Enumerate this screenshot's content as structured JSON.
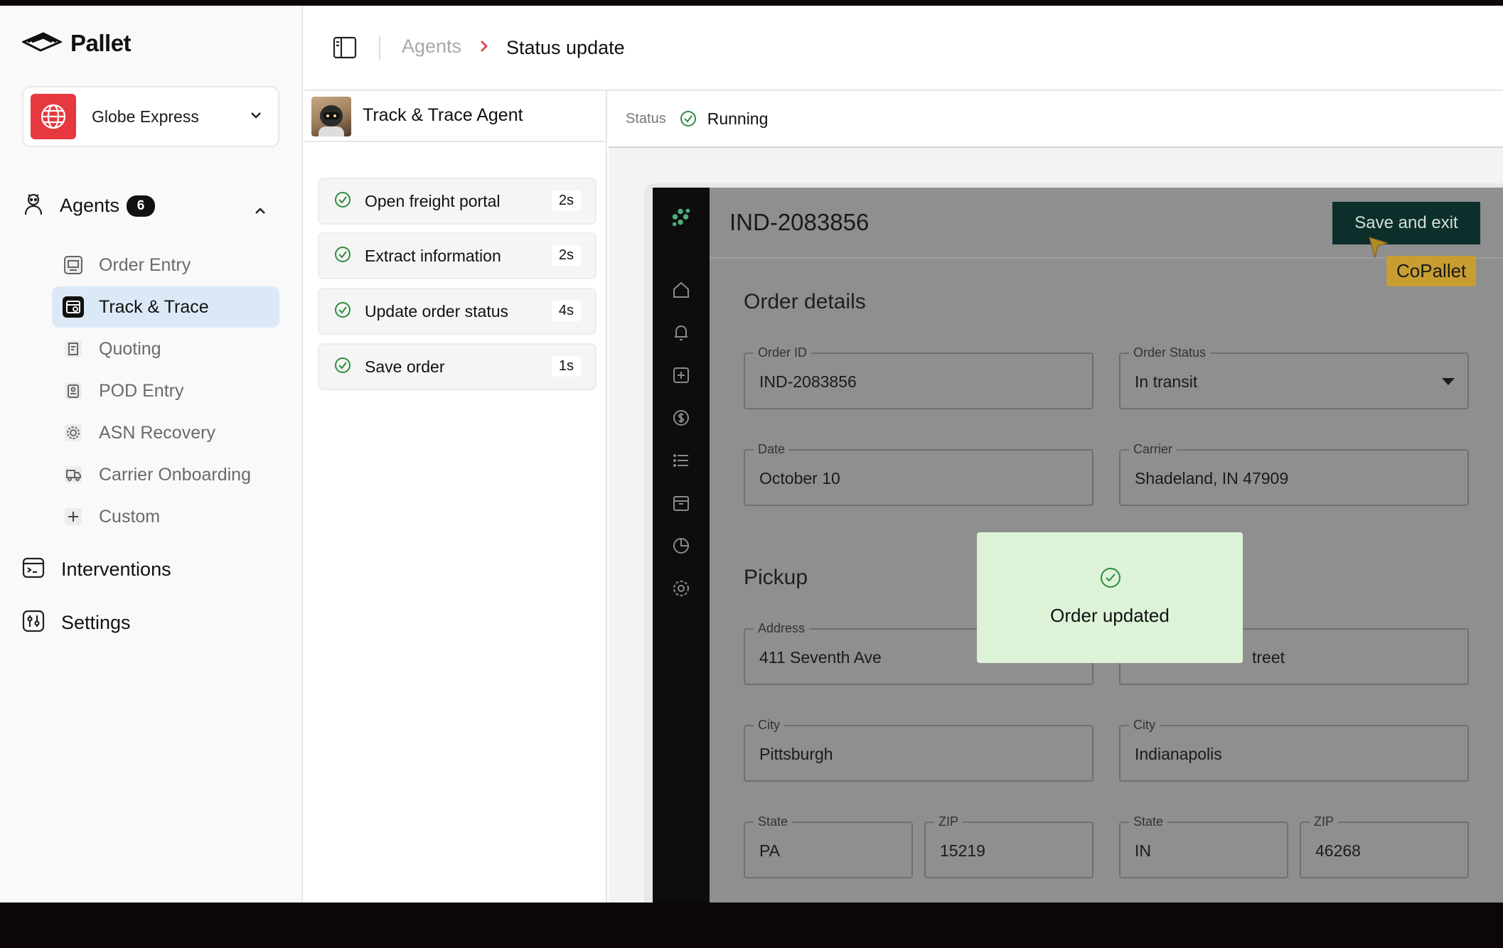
{
  "brand": {
    "name": "Pallet"
  },
  "org": {
    "name": "Globe Express"
  },
  "sidebar": {
    "agents_label": "Agents",
    "agents_count": "6",
    "agent_items": [
      {
        "label": "Order Entry",
        "icon": "monitor-icon"
      },
      {
        "label": "Track & Trace",
        "icon": "track-trace-icon",
        "active": true
      },
      {
        "label": "Quoting",
        "icon": "receipt-icon"
      },
      {
        "label": "POD Entry",
        "icon": "clipboard-icon"
      },
      {
        "label": "ASN Recovery",
        "icon": "gear-icon"
      },
      {
        "label": "Carrier Onboarding",
        "icon": "truck-icon"
      },
      {
        "label": "Custom",
        "icon": "plus-icon"
      }
    ],
    "interventions_label": "Interventions",
    "settings_label": "Settings"
  },
  "header": {
    "breadcrumb_parent": "Agents",
    "breadcrumb_current": "Status update"
  },
  "agent_panel": {
    "agent_name": "Track & Trace Agent",
    "steps": [
      {
        "label": "Open freight portal",
        "time": "2s"
      },
      {
        "label": "Extract information",
        "time": "2s"
      },
      {
        "label": "Update order status",
        "time": "4s"
      },
      {
        "label": "Save order",
        "time": "1s"
      }
    ]
  },
  "status": {
    "label": "Status",
    "value": "Running"
  },
  "app": {
    "order_title": "IND-2083856",
    "save_button": "Save and exit",
    "copallet_label": "CoPallet",
    "order_details_heading": "Order details",
    "pickup_heading": "Pickup",
    "fields": {
      "order_id": {
        "label": "Order ID",
        "value": "IND-2083856"
      },
      "order_status": {
        "label": "Order Status",
        "value": "In transit"
      },
      "date": {
        "label": "Date",
        "value": "October 10"
      },
      "carrier": {
        "label": "Carrier",
        "value": "Shadeland, IN 47909"
      },
      "pickup_address": {
        "label": "Address",
        "value": "411 Seventh Ave"
      },
      "delivery_address_partial": {
        "value": "treet"
      },
      "pickup_city": {
        "label": "City",
        "value": "Pittsburgh"
      },
      "delivery_city": {
        "label": "City",
        "value": "Indianapolis"
      },
      "pickup_state": {
        "label": "State",
        "value": "PA"
      },
      "pickup_zip": {
        "label": "ZIP",
        "value": "15219"
      },
      "delivery_state": {
        "label": "State",
        "value": "IN"
      },
      "delivery_zip": {
        "label": "ZIP",
        "value": "46268"
      }
    },
    "toast": "Order updated"
  },
  "colors": {
    "accent_red": "#e5393f",
    "active_nav_bg": "#dbe9f7",
    "success_green": "#2e8b3e",
    "save_button_bg": "#0d2f2c",
    "copallet_bg": "#c89e31",
    "toast_bg": "#dcf3d8"
  }
}
